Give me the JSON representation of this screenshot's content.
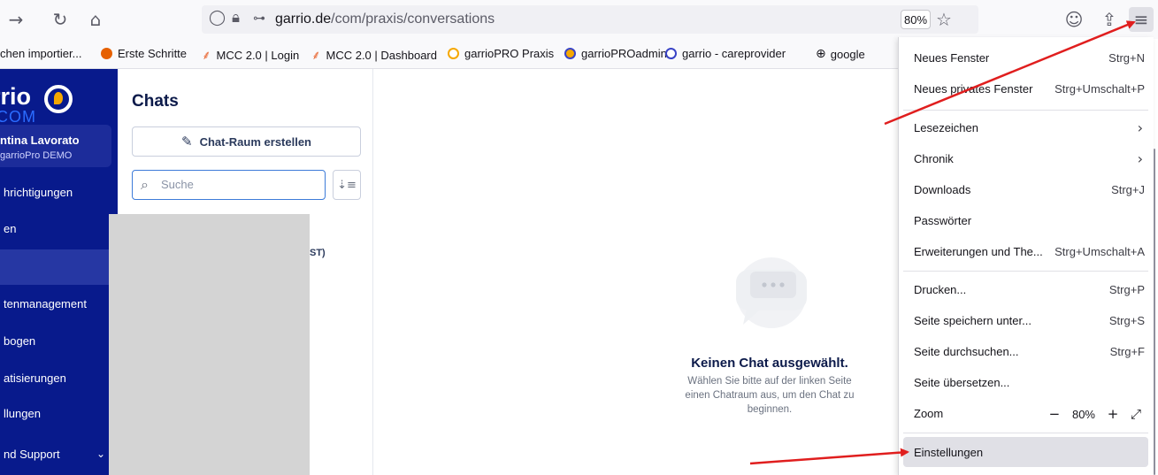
{
  "browser": {
    "url_host": "garrio.de",
    "url_path": "/com/praxis/conversations",
    "zoom": "80%",
    "icons": [
      "forward-icon",
      "reload-icon",
      "home-icon",
      "shield-icon",
      "lock-icon",
      "permissions-icon",
      "star-icon",
      "account-icon",
      "extensions-icon",
      "menu-icon"
    ]
  },
  "bookmarks": [
    {
      "label": "chen importier..."
    },
    {
      "label": "Erste Schritte"
    },
    {
      "label": "MCC 2.0 | Login"
    },
    {
      "label": "MCC 2.0 | Dashboard"
    },
    {
      "label": "garrioPRO Praxis"
    },
    {
      "label": "garrioPROadmin"
    },
    {
      "label": "garrio - careprovider"
    },
    {
      "label": "google"
    }
  ],
  "sidebar": {
    "brand": "rrio",
    "brand_sub": "COM",
    "user_name": "ntina Lavorato",
    "user_org": "garrioPro DEMO",
    "items": [
      {
        "label": "hrichtigungen"
      },
      {
        "label": "en"
      },
      {
        "label": ""
      },
      {
        "label": "tenmanagement"
      },
      {
        "label": "bogen"
      },
      {
        "label": "atisierungen"
      },
      {
        "label": "llungen"
      },
      {
        "label": "nd Support"
      }
    ]
  },
  "chats": {
    "title": "Chats",
    "create_label": "Chat-Raum erstellen",
    "search_placeholder": "Suche",
    "partial_item": "ST)"
  },
  "empty_state": {
    "title": "Keinen Chat ausgewählt.",
    "text": "Wählen Sie bitte auf der linken Seite einen Chatraum aus, um den Chat zu beginnen."
  },
  "menu": {
    "items": [
      {
        "label": "Neues Fenster",
        "shortcut": "Strg+N"
      },
      {
        "label": "Neues privates Fenster",
        "shortcut": "Strg+Umschalt+P"
      },
      {
        "label": "Lesezeichen",
        "shortcut": ""
      },
      {
        "label": "Chronik",
        "shortcut": ""
      },
      {
        "label": "Downloads",
        "shortcut": "Strg+J"
      },
      {
        "label": "Passwörter",
        "shortcut": ""
      },
      {
        "label": "Erweiterungen und The...",
        "shortcut": "Strg+Umschalt+A"
      },
      {
        "label": "Drucken...",
        "shortcut": "Strg+P"
      },
      {
        "label": "Seite speichern unter...",
        "shortcut": "Strg+S"
      },
      {
        "label": "Seite durchsuchen...",
        "shortcut": "Strg+F"
      },
      {
        "label": "Seite übersetzen...",
        "shortcut": ""
      },
      {
        "label": "Zoom",
        "shortcut": ""
      },
      {
        "label": "Einstellungen",
        "shortcut": ""
      }
    ],
    "zoom_value": "80%",
    "zoom_minus": "−",
    "zoom_plus": "+"
  },
  "colors": {
    "sidebar_bg": "#081a8c",
    "annotation_arrow": "#e01e1e",
    "accent_blue": "#3d7bd9"
  }
}
